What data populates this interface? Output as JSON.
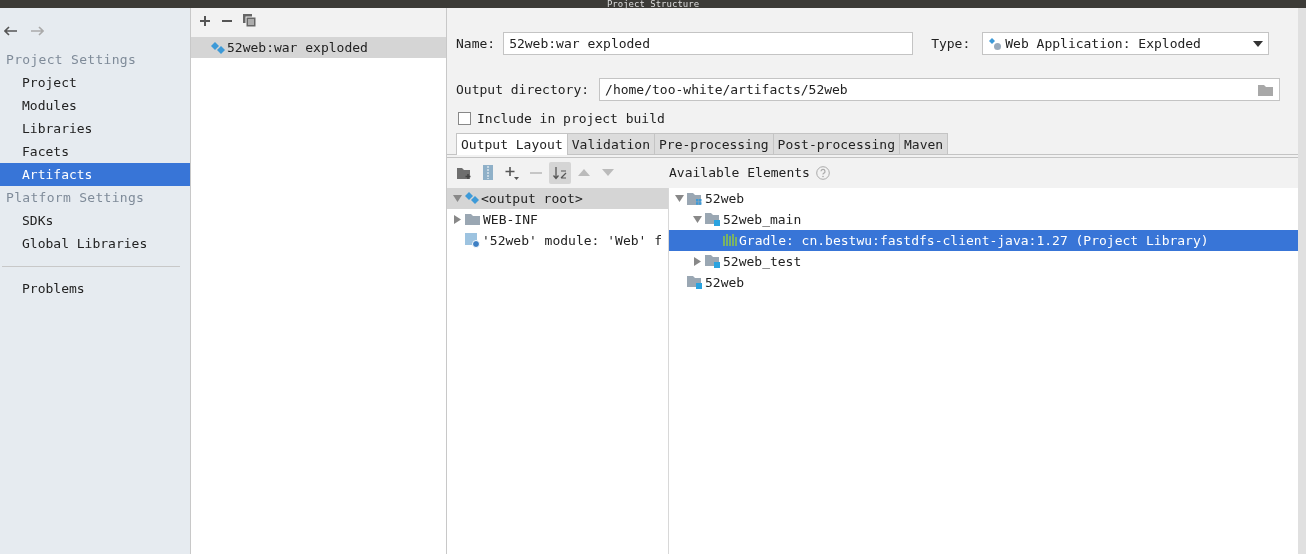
{
  "window": {
    "title": "Project Structure"
  },
  "sidebar": {
    "sections": [
      {
        "heading": "Project Settings",
        "items": [
          {
            "label": "Project",
            "selected": false
          },
          {
            "label": "Modules",
            "selected": false
          },
          {
            "label": "Libraries",
            "selected": false
          },
          {
            "label": "Facets",
            "selected": false
          },
          {
            "label": "Artifacts",
            "selected": true
          }
        ]
      },
      {
        "heading": "Platform Settings",
        "items": [
          {
            "label": "SDKs",
            "selected": false
          },
          {
            "label": "Global Libraries",
            "selected": false
          }
        ]
      }
    ],
    "footer_items": [
      {
        "label": "Problems",
        "selected": false
      }
    ]
  },
  "artifacts": [
    {
      "label": "52web:war exploded",
      "selected": true
    }
  ],
  "form": {
    "name_label": "Name:",
    "name": "52web:war exploded",
    "type_label": "Type:",
    "type": "Web Application: Exploded",
    "output_label": "Output directory:",
    "output": "/home/too-white/artifacts/52web",
    "include_label": "Include in project build",
    "include_checked": false
  },
  "tabs": [
    {
      "label": "Output Layout",
      "selected": true
    },
    {
      "label": "Validation",
      "selected": false
    },
    {
      "label": "Pre-processing",
      "selected": false
    },
    {
      "label": "Post-processing",
      "selected": false
    },
    {
      "label": "Maven",
      "selected": false
    }
  ],
  "available_label": "Available Elements",
  "output_tree": [
    {
      "kind": "root",
      "label": "<output root>",
      "selected": true,
      "expanded": true,
      "children": [
        {
          "kind": "folder",
          "label": "WEB-INF",
          "selected": false,
          "expanded": false
        },
        {
          "kind": "facet",
          "label": "'52web' module: 'Web' f",
          "selected": false
        }
      ]
    }
  ],
  "available_tree": [
    {
      "kind": "module",
      "label": "52web",
      "selected": false,
      "expanded": true,
      "children": [
        {
          "kind": "source",
          "label": "52web_main",
          "selected": false,
          "expanded": true,
          "children": [
            {
              "kind": "library",
              "label": "Gradle: cn.bestwu:fastdfs-client-java:1.27 (Project Library)",
              "selected": true
            }
          ]
        },
        {
          "kind": "source",
          "label": "52web_test",
          "selected": false,
          "expanded": false
        }
      ]
    },
    {
      "kind": "source",
      "label": "52web",
      "selected": false
    }
  ]
}
